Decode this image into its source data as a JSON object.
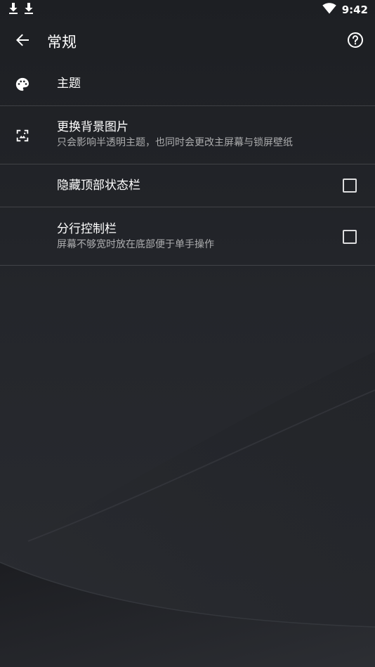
{
  "status_bar": {
    "time": "9:42",
    "left_icons": [
      "download-icon",
      "download-icon"
    ],
    "right_icons": [
      "wifi-icon"
    ]
  },
  "app_bar": {
    "title": "常规",
    "back_icon": "arrow-back-icon",
    "help_icon": "help-circle-icon"
  },
  "settings": [
    {
      "icon": "palette-icon",
      "title": "主题",
      "subtitle": ""
    },
    {
      "icon": "wallpaper-icon",
      "title": "更换背景图片",
      "subtitle": "只会影响半透明主题，也同时会更改主屏幕与锁屏壁纸"
    },
    {
      "icon": "",
      "title": "隐藏顶部状态栏",
      "subtitle": "",
      "checkbox": false
    },
    {
      "icon": "",
      "title": "分行控制栏",
      "subtitle": "屏幕不够宽时放在底部便于单手操作",
      "checkbox": false
    }
  ],
  "colors": {
    "background": "#23252a",
    "text_primary": "#ffffff",
    "text_secondary": "#a7a8aa",
    "divider": "#3a3c40"
  }
}
